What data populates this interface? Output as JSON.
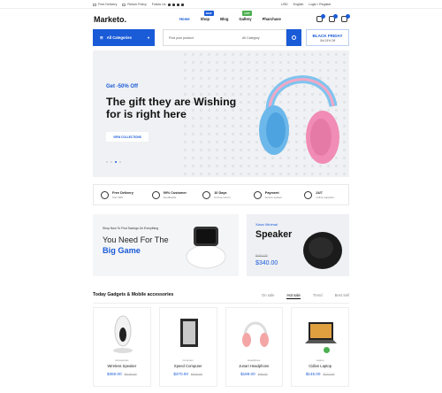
{
  "topbar": {
    "left": [
      "Free Delivery",
      "Return Policy",
      "Follow Us"
    ],
    "currency": "USD",
    "language": "English",
    "auth": "Login / Register"
  },
  "header": {
    "logo": "Marketo.",
    "nav": [
      "Home",
      "Shop",
      "Blog",
      "Gallery",
      "Pharchase"
    ],
    "badges": {
      "shop": "NEW",
      "gallery": "HOT"
    }
  },
  "search": {
    "categories_label": "All Categories",
    "placeholder": "Find your product",
    "category_select": "All Category",
    "promo_title": "BLACK FRIDAY",
    "promo_sub": "Get 15% Off"
  },
  "hero": {
    "offer": "Get -50% Off",
    "title": "The gift they are Wishing for is right here",
    "button": "VIEW COLLECTIONS"
  },
  "features": [
    {
      "title": "Free Delivery",
      "sub": "from $19"
    },
    {
      "title": "99% Customer",
      "sub": "Feedbacks"
    },
    {
      "title": "10 Days",
      "sub": "for free return"
    },
    {
      "title": "Payment",
      "sub": "secure system"
    },
    {
      "title": "24/7",
      "sub": "online supports"
    }
  ],
  "banner1": {
    "small": "Shop Now To Find Savings On Everything",
    "line1": "You Need For The",
    "line2": "Big Game"
  },
  "banner2": {
    "small": "Xiaox Minimal",
    "title": "Speaker",
    "old_price": "$450.00",
    "price": "$340.00"
  },
  "section": {
    "title": "Today Gadgets & Mobile accessories",
    "tabs": [
      "On sale",
      "Hot sale",
      "Trend",
      "Best Sell"
    ]
  },
  "products": [
    {
      "category": "Accessories",
      "name": "Wireless Speaker",
      "price": "$450.00",
      "old": "$6.50.00"
    },
    {
      "category": "Computer",
      "name": "Xpeed Computer",
      "price": "$370.00",
      "old": "$520.00"
    },
    {
      "category": "Headphone",
      "name": "Junari Headphone",
      "price": "$189.00",
      "old": "$25.00"
    },
    {
      "category": "Laptop",
      "name": "Cidlan Laptop",
      "price": "$145.00",
      "old": "$222.00"
    }
  ],
  "colors": {
    "accent": "#1a5bd8",
    "hot": "#4caf50"
  }
}
